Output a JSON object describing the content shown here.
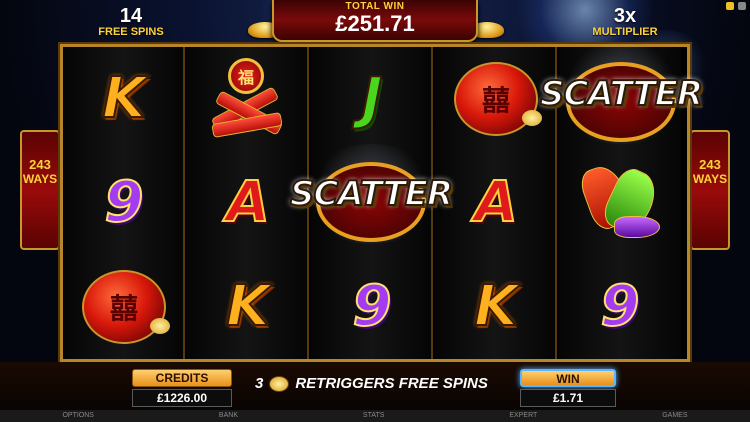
{
  "header": {
    "free_spins_count": "14",
    "free_spins_label": "FREE SPINS",
    "total_win_label": "TOTAL WIN",
    "total_win_value": "£251.71",
    "multiplier_value": "3x",
    "multiplier_label": "MULTIPLIER"
  },
  "ways": {
    "count": "243",
    "label": "WAYS"
  },
  "reels": [
    [
      "K",
      "9",
      "lantern"
    ],
    [
      "firecrackers",
      "A",
      "K"
    ],
    [
      "J",
      "scatter",
      "9"
    ],
    [
      "lantern",
      "A",
      "K"
    ],
    [
      "scatter",
      "rocket",
      "9"
    ]
  ],
  "symbols": {
    "scatter_text": "SCATTER",
    "lantern_glyph": "囍",
    "medal_glyph": "福"
  },
  "bottom": {
    "credits_label": "CREDITS",
    "credits_value": "£1226.00",
    "retrigger_count": "3",
    "retrigger_text": "RETRIGGERS FREE SPINS",
    "win_label": "WIN",
    "win_value": "£1.71"
  },
  "menu": [
    "OPTIONS",
    "BANK",
    "STATS",
    "EXPERT",
    "GAMES"
  ],
  "colors": {
    "gold": "#ffd23a",
    "frame": "#b8862a",
    "win_highlight": "#5ab4ff"
  }
}
